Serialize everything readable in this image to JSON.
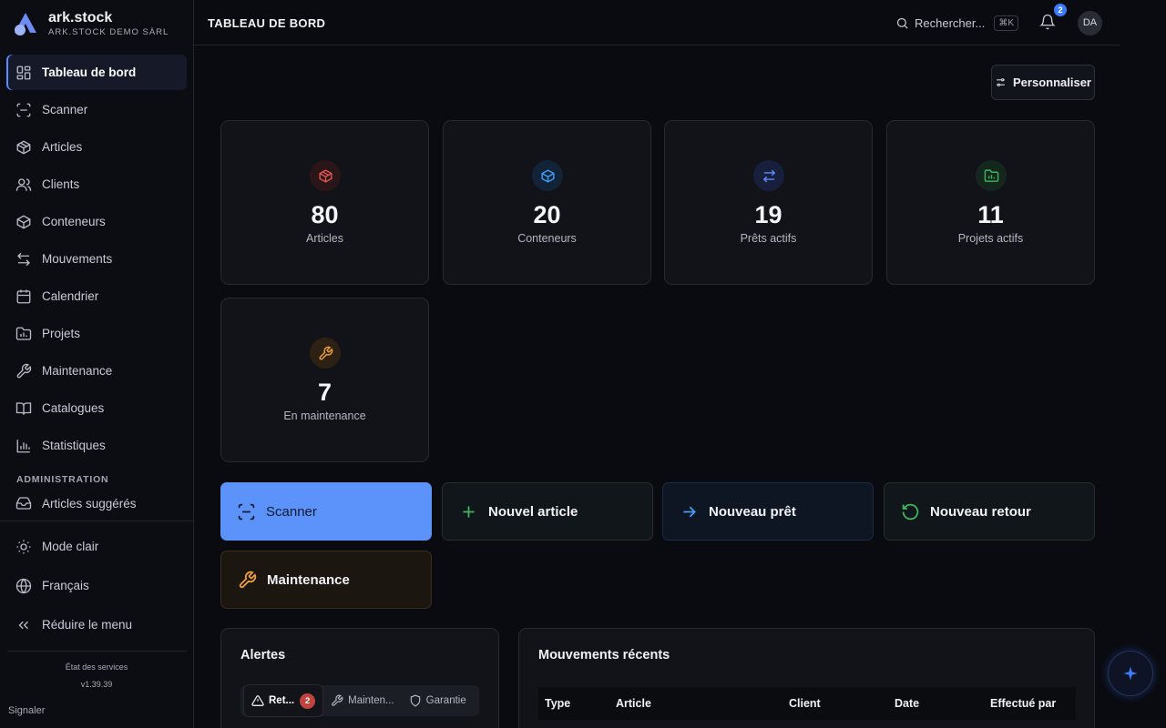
{
  "brand": {
    "name": "ark.stock",
    "subtitle": "ARK.STOCK DEMO SÀRL"
  },
  "header": {
    "title": "TABLEAU DE BORD",
    "search_label": "Rechercher...",
    "search_shortcut": "⌘K",
    "notification_count": "2",
    "avatar_initials": "DA"
  },
  "sidebar": {
    "items": [
      {
        "label": "Tableau de bord",
        "icon": "dashboard-icon"
      },
      {
        "label": "Scanner",
        "icon": "scan-icon"
      },
      {
        "label": "Articles",
        "icon": "box-icon"
      },
      {
        "label": "Clients",
        "icon": "users-icon"
      },
      {
        "label": "Conteneurs",
        "icon": "container-icon"
      },
      {
        "label": "Mouvements",
        "icon": "arrows-icon"
      },
      {
        "label": "Calendrier",
        "icon": "calendar-icon"
      },
      {
        "label": "Projets",
        "icon": "folder-icon"
      },
      {
        "label": "Maintenance",
        "icon": "wrench-icon"
      },
      {
        "label": "Catalogues",
        "icon": "book-icon"
      },
      {
        "label": "Statistiques",
        "icon": "chart-icon"
      }
    ],
    "admin_section": "ADMINISTRATION",
    "admin_items": [
      {
        "label": "Articles suggérés",
        "icon": "inbox-icon"
      }
    ],
    "bottom": {
      "theme_toggle": "Mode clair",
      "language": "Français",
      "collapse": "Réduire le menu",
      "status_link": "État des services",
      "version": "v1.39.39",
      "report": "Signaler"
    }
  },
  "main": {
    "customize_label": "Personnaliser",
    "stats": [
      {
        "value": "80",
        "label": "Articles",
        "color": "#e0564f"
      },
      {
        "value": "20",
        "label": "Conteneurs",
        "color": "#3f9ef5"
      },
      {
        "value": "19",
        "label": "Prêts actifs",
        "color": "#5f8cff"
      },
      {
        "value": "11",
        "label": "Projets actifs",
        "color": "#3fb561"
      },
      {
        "value": "7",
        "label": "En maintenance",
        "color": "#f0a23c"
      }
    ],
    "quick_actions": [
      {
        "label": "Scanner",
        "icon": "scan-icon"
      },
      {
        "label": "Nouvel article",
        "icon": "plus-icon"
      },
      {
        "label": "Nouveau prêt",
        "icon": "arrow-right-icon"
      },
      {
        "label": "Nouveau retour",
        "icon": "rotate-ccw-icon"
      },
      {
        "label": "Maintenance",
        "icon": "wrench-icon"
      }
    ],
    "alerts": {
      "title": "Alertes",
      "tabs": [
        {
          "label": "Ret...",
          "badge": "2"
        },
        {
          "label": "Mainten..."
        },
        {
          "label": "Garantie"
        }
      ]
    },
    "movements": {
      "title": "Mouvements récents",
      "columns": [
        "Type",
        "Article",
        "Client",
        "Date",
        "Effectué par"
      ]
    }
  },
  "colors": {
    "accent": "#5a8cff",
    "background": "#0a0b10",
    "card": "#111318"
  }
}
